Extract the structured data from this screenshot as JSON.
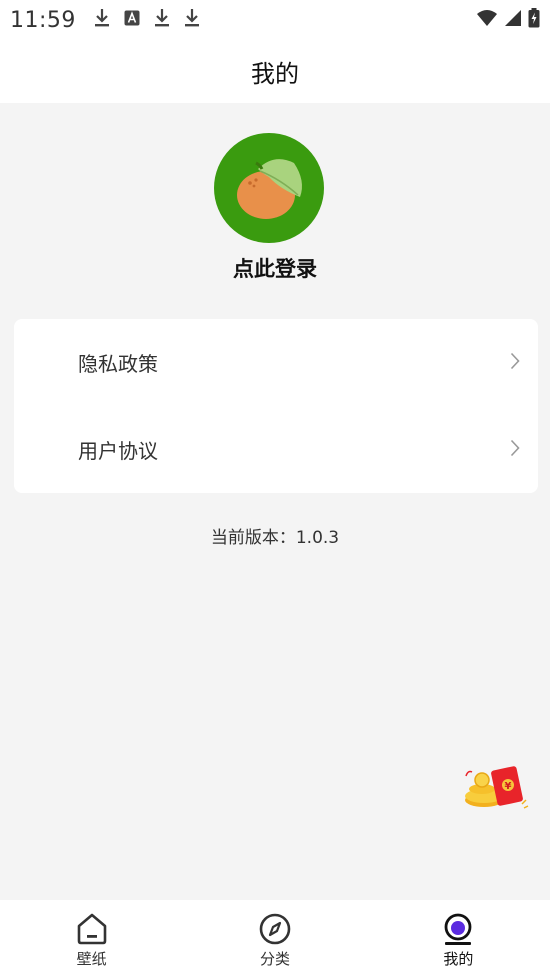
{
  "status_bar": {
    "time": "11:59",
    "notification_icons": [
      "download-icon",
      "a-box-icon",
      "download-icon",
      "download-icon"
    ],
    "system_icons": [
      "wifi-icon",
      "signal-icon",
      "battery-charging-icon"
    ]
  },
  "header": {
    "title": "我的"
  },
  "profile": {
    "avatar_icon": "orange-fruit-icon",
    "avatar_bg": "#3a9b0f",
    "login_label": "点此登录"
  },
  "menu": {
    "items": [
      {
        "label": "隐私政策",
        "icon": "chevron-right-icon"
      },
      {
        "label": "用户协议",
        "icon": "chevron-right-icon"
      }
    ]
  },
  "version": {
    "text": "当前版本：1.0.3"
  },
  "floating": {
    "icon": "red-packet-icon"
  },
  "tabbar": {
    "tabs": [
      {
        "label": "壁纸",
        "icon": "wallpaper-icon",
        "active": false
      },
      {
        "label": "分类",
        "icon": "compass-icon",
        "active": false
      },
      {
        "label": "我的",
        "icon": "profile-icon",
        "active": true
      }
    ],
    "accent": "#5b2be0"
  }
}
